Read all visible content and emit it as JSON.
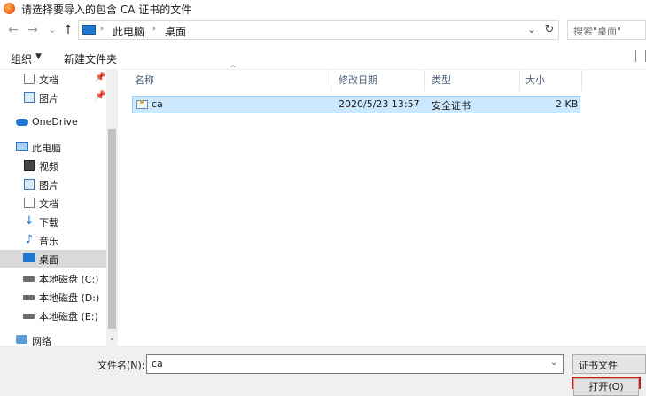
{
  "window": {
    "title": "请选择要导入的包含 CA 证书的文件",
    "app_icon": "firefox-icon"
  },
  "navigation": {
    "back_icon": "←",
    "forward_icon": "→",
    "recent_icon": "⌄",
    "up_icon": "↑",
    "breadcrumb": [
      "此电脑",
      "桌面"
    ],
    "separator": "›",
    "dropdown_icon": "⌄",
    "refresh_icon": "↻",
    "search_placeholder": "搜索\"桌面\""
  },
  "toolbar": {
    "organize_label": "组织",
    "organize_caret": "▼",
    "new_folder_label": "新建文件夹"
  },
  "sidebar": {
    "items": [
      {
        "label": "文档",
        "icon": "document-icon",
        "pinned": true
      },
      {
        "label": "图片",
        "icon": "picture-icon",
        "pinned": true
      },
      {
        "label": "OneDrive",
        "icon": "cloud-icon",
        "pinned": false
      },
      {
        "label": "此电脑",
        "icon": "pc-icon",
        "pinned": false
      },
      {
        "label": "视频",
        "icon": "video-icon",
        "pinned": false
      },
      {
        "label": "图片",
        "icon": "picture-icon",
        "pinned": false
      },
      {
        "label": "文档",
        "icon": "document-icon",
        "pinned": false
      },
      {
        "label": "下载",
        "icon": "download-icon",
        "pinned": false
      },
      {
        "label": "音乐",
        "icon": "music-icon",
        "pinned": false
      },
      {
        "label": "桌面",
        "icon": "desktop-icon",
        "pinned": false,
        "selected": true
      },
      {
        "label": "本地磁盘 (C:)",
        "icon": "drive-icon",
        "pinned": false
      },
      {
        "label": "本地磁盘 (D:)",
        "icon": "drive-icon",
        "pinned": false
      },
      {
        "label": "本地磁盘 (E:)",
        "icon": "drive-icon",
        "pinned": false
      },
      {
        "label": "网络",
        "icon": "network-icon",
        "pinned": false
      }
    ],
    "pin_glyph": "📌",
    "scroll_down_glyph": "⌄"
  },
  "filelist": {
    "columns": [
      "名称",
      "修改日期",
      "类型",
      "大小"
    ],
    "sort_caret": "^",
    "rows": [
      {
        "name": "ca",
        "modified": "2020/5/23 13:57",
        "type": "安全证书",
        "size": "2 KB",
        "selected": true
      }
    ]
  },
  "footer": {
    "filename_label": "文件名(N):",
    "filename_value": "ca",
    "filename_caret": "⌄",
    "filetype_label": "证书文件",
    "open_button_label": "打开(O)"
  },
  "colors": {
    "selection_bg": "#cce8ff",
    "selection_border": "#99d1ff",
    "highlight_red": "#d11c1c",
    "accent_blue": "#1e78d2"
  }
}
